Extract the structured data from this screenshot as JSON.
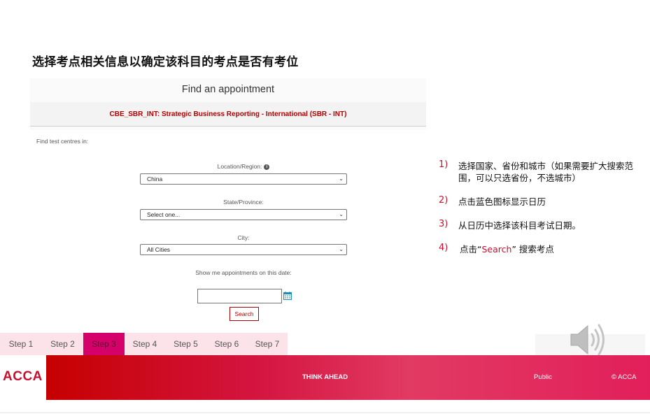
{
  "slide": {
    "title": "选择考点相关信息以确定该科目的考点是否有考位"
  },
  "appointment_form": {
    "title": "Find an appointment",
    "course": "CBE_SBR_INT: Strategic Business Reporting - International (SBR - INT)",
    "find_label": "Find test centres in:",
    "location": {
      "label": "Location/Region:",
      "value": "China"
    },
    "state": {
      "label": "State/Province:",
      "value": "Select one..."
    },
    "city": {
      "label": "City:",
      "value": "All Cities"
    },
    "date": {
      "label": "Show me appointments on this date:",
      "value": ""
    },
    "search_label": "Search"
  },
  "instructions": [
    {
      "num": "1)",
      "text": "选择国家、省份和城市（如果需要扩大搜索范围，可以只选省份，不选城市）"
    },
    {
      "num": "2)",
      "text": "点击蓝色图标显示日历"
    },
    {
      "num": "3)",
      "text": "从日历中选择该科目考试日期。"
    },
    {
      "num": "4)",
      "text_before": "点击“",
      "highlight": "Search",
      "text_after": "” 搜索考点"
    }
  ],
  "steps": [
    "Step 1",
    "Step 2",
    "Step 3",
    "Step 4",
    "Step 5",
    "Step 6",
    "Step 7"
  ],
  "active_step": "Step 3",
  "footer": {
    "logo": "ACCA",
    "tagline": "THINK AHEAD",
    "classification": "Public",
    "copyright": "© ACCA"
  },
  "colors": {
    "accent_red": "#c8102e",
    "active_step": "#d6006b",
    "step_bg": "#fbe3e9",
    "calendar_icon": "#1a8fb4"
  },
  "icons": [
    "info-icon",
    "calendar-icon",
    "speaker-icon",
    "chevron-down-icon"
  ]
}
